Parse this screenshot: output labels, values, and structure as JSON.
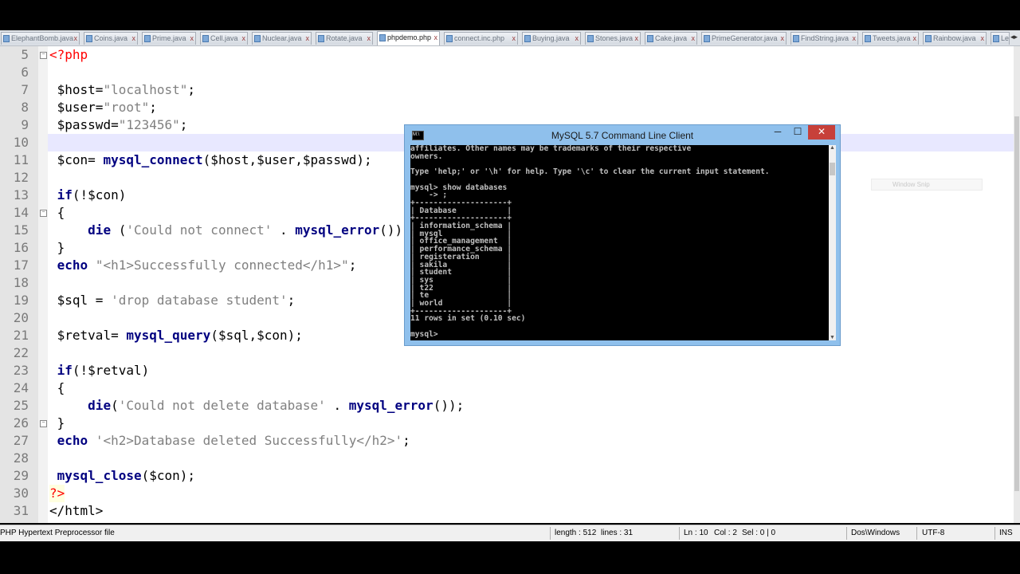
{
  "tabs": [
    {
      "label": "ElephantBomb.java",
      "active": false
    },
    {
      "label": "Coins.java",
      "active": false
    },
    {
      "label": "Prime.java",
      "active": false
    },
    {
      "label": "Cell.java",
      "active": false
    },
    {
      "label": "Nuclear.java",
      "active": false
    },
    {
      "label": "Rotate.java",
      "active": false
    },
    {
      "label": "phpdemo.php",
      "active": true
    },
    {
      "label": "connect.inc.php",
      "active": false
    },
    {
      "label": "Buying.java",
      "active": false
    },
    {
      "label": "Stones.java",
      "active": false
    },
    {
      "label": "Cake.java",
      "active": false
    },
    {
      "label": "PrimeGenerator.java",
      "active": false
    },
    {
      "label": "FindString.java",
      "active": false
    },
    {
      "label": "Tweets.java",
      "active": false
    },
    {
      "label": "Rainbow.java",
      "active": false
    },
    {
      "label": "Le",
      "active": false
    }
  ],
  "lines": [
    {
      "n": "5"
    },
    {
      "n": "6"
    },
    {
      "n": "7"
    },
    {
      "n": "8"
    },
    {
      "n": "9"
    },
    {
      "n": "10"
    },
    {
      "n": "11"
    },
    {
      "n": "12"
    },
    {
      "n": "13"
    },
    {
      "n": "14"
    },
    {
      "n": "15"
    },
    {
      "n": "16"
    },
    {
      "n": "17"
    },
    {
      "n": "18"
    },
    {
      "n": "19"
    },
    {
      "n": "20"
    },
    {
      "n": "21"
    },
    {
      "n": "22"
    },
    {
      "n": "23"
    },
    {
      "n": "24"
    },
    {
      "n": "25"
    },
    {
      "n": "26"
    },
    {
      "n": "27"
    },
    {
      "n": "28"
    },
    {
      "n": "29"
    },
    {
      "n": "30"
    },
    {
      "n": "31"
    }
  ],
  "code": {
    "l5_open": "<?php",
    "l7_var": "$host=",
    "l7_str": "\"localhost\"",
    "l7_end": ";",
    "l8_var": "$user=",
    "l8_str": "\"root\"",
    "l8_end": ";",
    "l9_var": "$passwd=",
    "l9_str": "\"123456\"",
    "l9_end": ";",
    "l11_var": "$con= ",
    "l11_fn": "mysql_connect",
    "l11_args": "($host,$user,$passwd);",
    "l13_kw": "if",
    "l13_rest": "(!$con)",
    "l14_brace": "{",
    "l15_fn": "die",
    "l15_str": "'Could not connect'",
    "l15_dot": " . ",
    "l15_fn2": "mysql_error",
    "l15_end": "());",
    "l16_brace": "}",
    "l17_kw": "echo",
    "l17_str": "\"<h1>Successfully connected</h1>\"",
    "l17_end": ";",
    "l19_var": "$sql",
    "l19_eq": " = ",
    "l19_str": "'drop database student'",
    "l19_end": ";",
    "l21_var": "$retval= ",
    "l21_fn": "mysql_query",
    "l21_args": "($sql,$con);",
    "l23_kw": "if",
    "l23_rest": "(!$retval)",
    "l24_brace": "{",
    "l25_fn": "die",
    "l25_open": "(",
    "l25_str": "'Could not delete database'",
    "l25_dot": " . ",
    "l25_fn2": "mysql_error",
    "l25_end": "());",
    "l26_brace": "}",
    "l27_kw": "echo",
    "l27_str": "'<h2>Database deleted Successfully</h2>'",
    "l27_end": ";",
    "l29_fn": "mysql_close",
    "l29_args": "($con);",
    "l30_close": "?>",
    "l31_html": "</html>"
  },
  "mysql_window": {
    "title": "MySQL 5.7 Command Line Client",
    "icon_label": "M:\\",
    "minimize": "─",
    "maximize": "☐",
    "close": "✕",
    "console_lines": [
      "affiliates. Other names may be trademarks of their respective",
      "owners.",
      "",
      "Type 'help;' or '\\h' for help. Type '\\c' to clear the current input statement.",
      "",
      "mysql> show databases",
      "    -> ;",
      "+--------------------+",
      "| Database           |",
      "+--------------------+",
      "| information_schema |",
      "| mysql              |",
      "| office_management  |",
      "| performance_schema |",
      "| registeration      |",
      "| sakila             |",
      "| student            |",
      "| sys                |",
      "| t22                |",
      "| te                 |",
      "| world              |",
      "+--------------------+",
      "11 rows in set (0.10 sec)",
      "",
      "mysql>"
    ]
  },
  "snip_label": "Window Snip",
  "status": {
    "file_type": "PHP Hypertext Preprocessor file",
    "length": "length : 512",
    "lines": "lines : 31",
    "ln": "Ln : 10",
    "col": "Col : 2",
    "sel": "Sel : 0 | 0",
    "eol": "Dos\\Windows",
    "encoding": "UTF-8",
    "mode": "INS"
  },
  "colors": {
    "keyword": "#000080",
    "string": "#808080",
    "php_tag": "#ff0000",
    "current_line": "#e8e8ff",
    "console_bg": "#000000",
    "titlebar": "#8fc0ec",
    "close_btn": "#c7403a"
  }
}
